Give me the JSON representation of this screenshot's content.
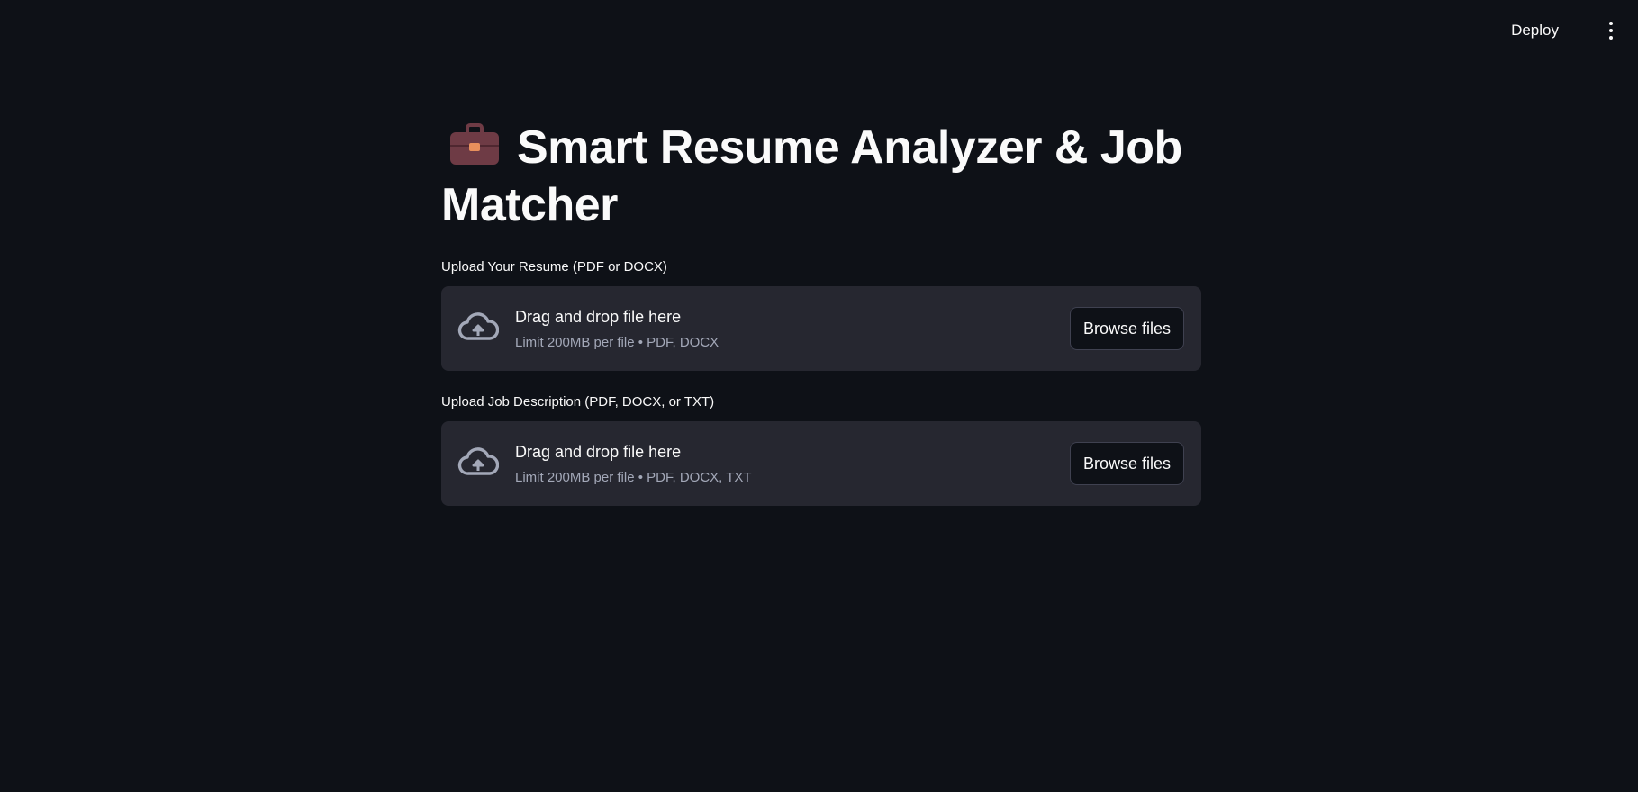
{
  "header": {
    "deploy_label": "Deploy",
    "menu_icon": "vertical-ellipsis-icon"
  },
  "main": {
    "title": "Smart Resume Analyzer & Job Matcher",
    "title_icon": "briefcase-icon",
    "uploaders": [
      {
        "label": "Upload Your Resume (PDF or DOCX)",
        "drop_text": "Drag and drop file here",
        "limit_text": "Limit 200MB per file • PDF, DOCX",
        "button_label": "Browse files",
        "icon": "cloud-upload-icon"
      },
      {
        "label": "Upload Job Description (PDF, DOCX, or TXT)",
        "drop_text": "Drag and drop file here",
        "limit_text": "Limit 200MB per file • PDF, DOCX, TXT",
        "button_label": "Browse files",
        "icon": "cloud-upload-icon"
      }
    ]
  },
  "colors": {
    "background": "#0e1117",
    "dropzone": "#262730",
    "text": "#fafafa",
    "muted_text": "#a3a8b8"
  }
}
